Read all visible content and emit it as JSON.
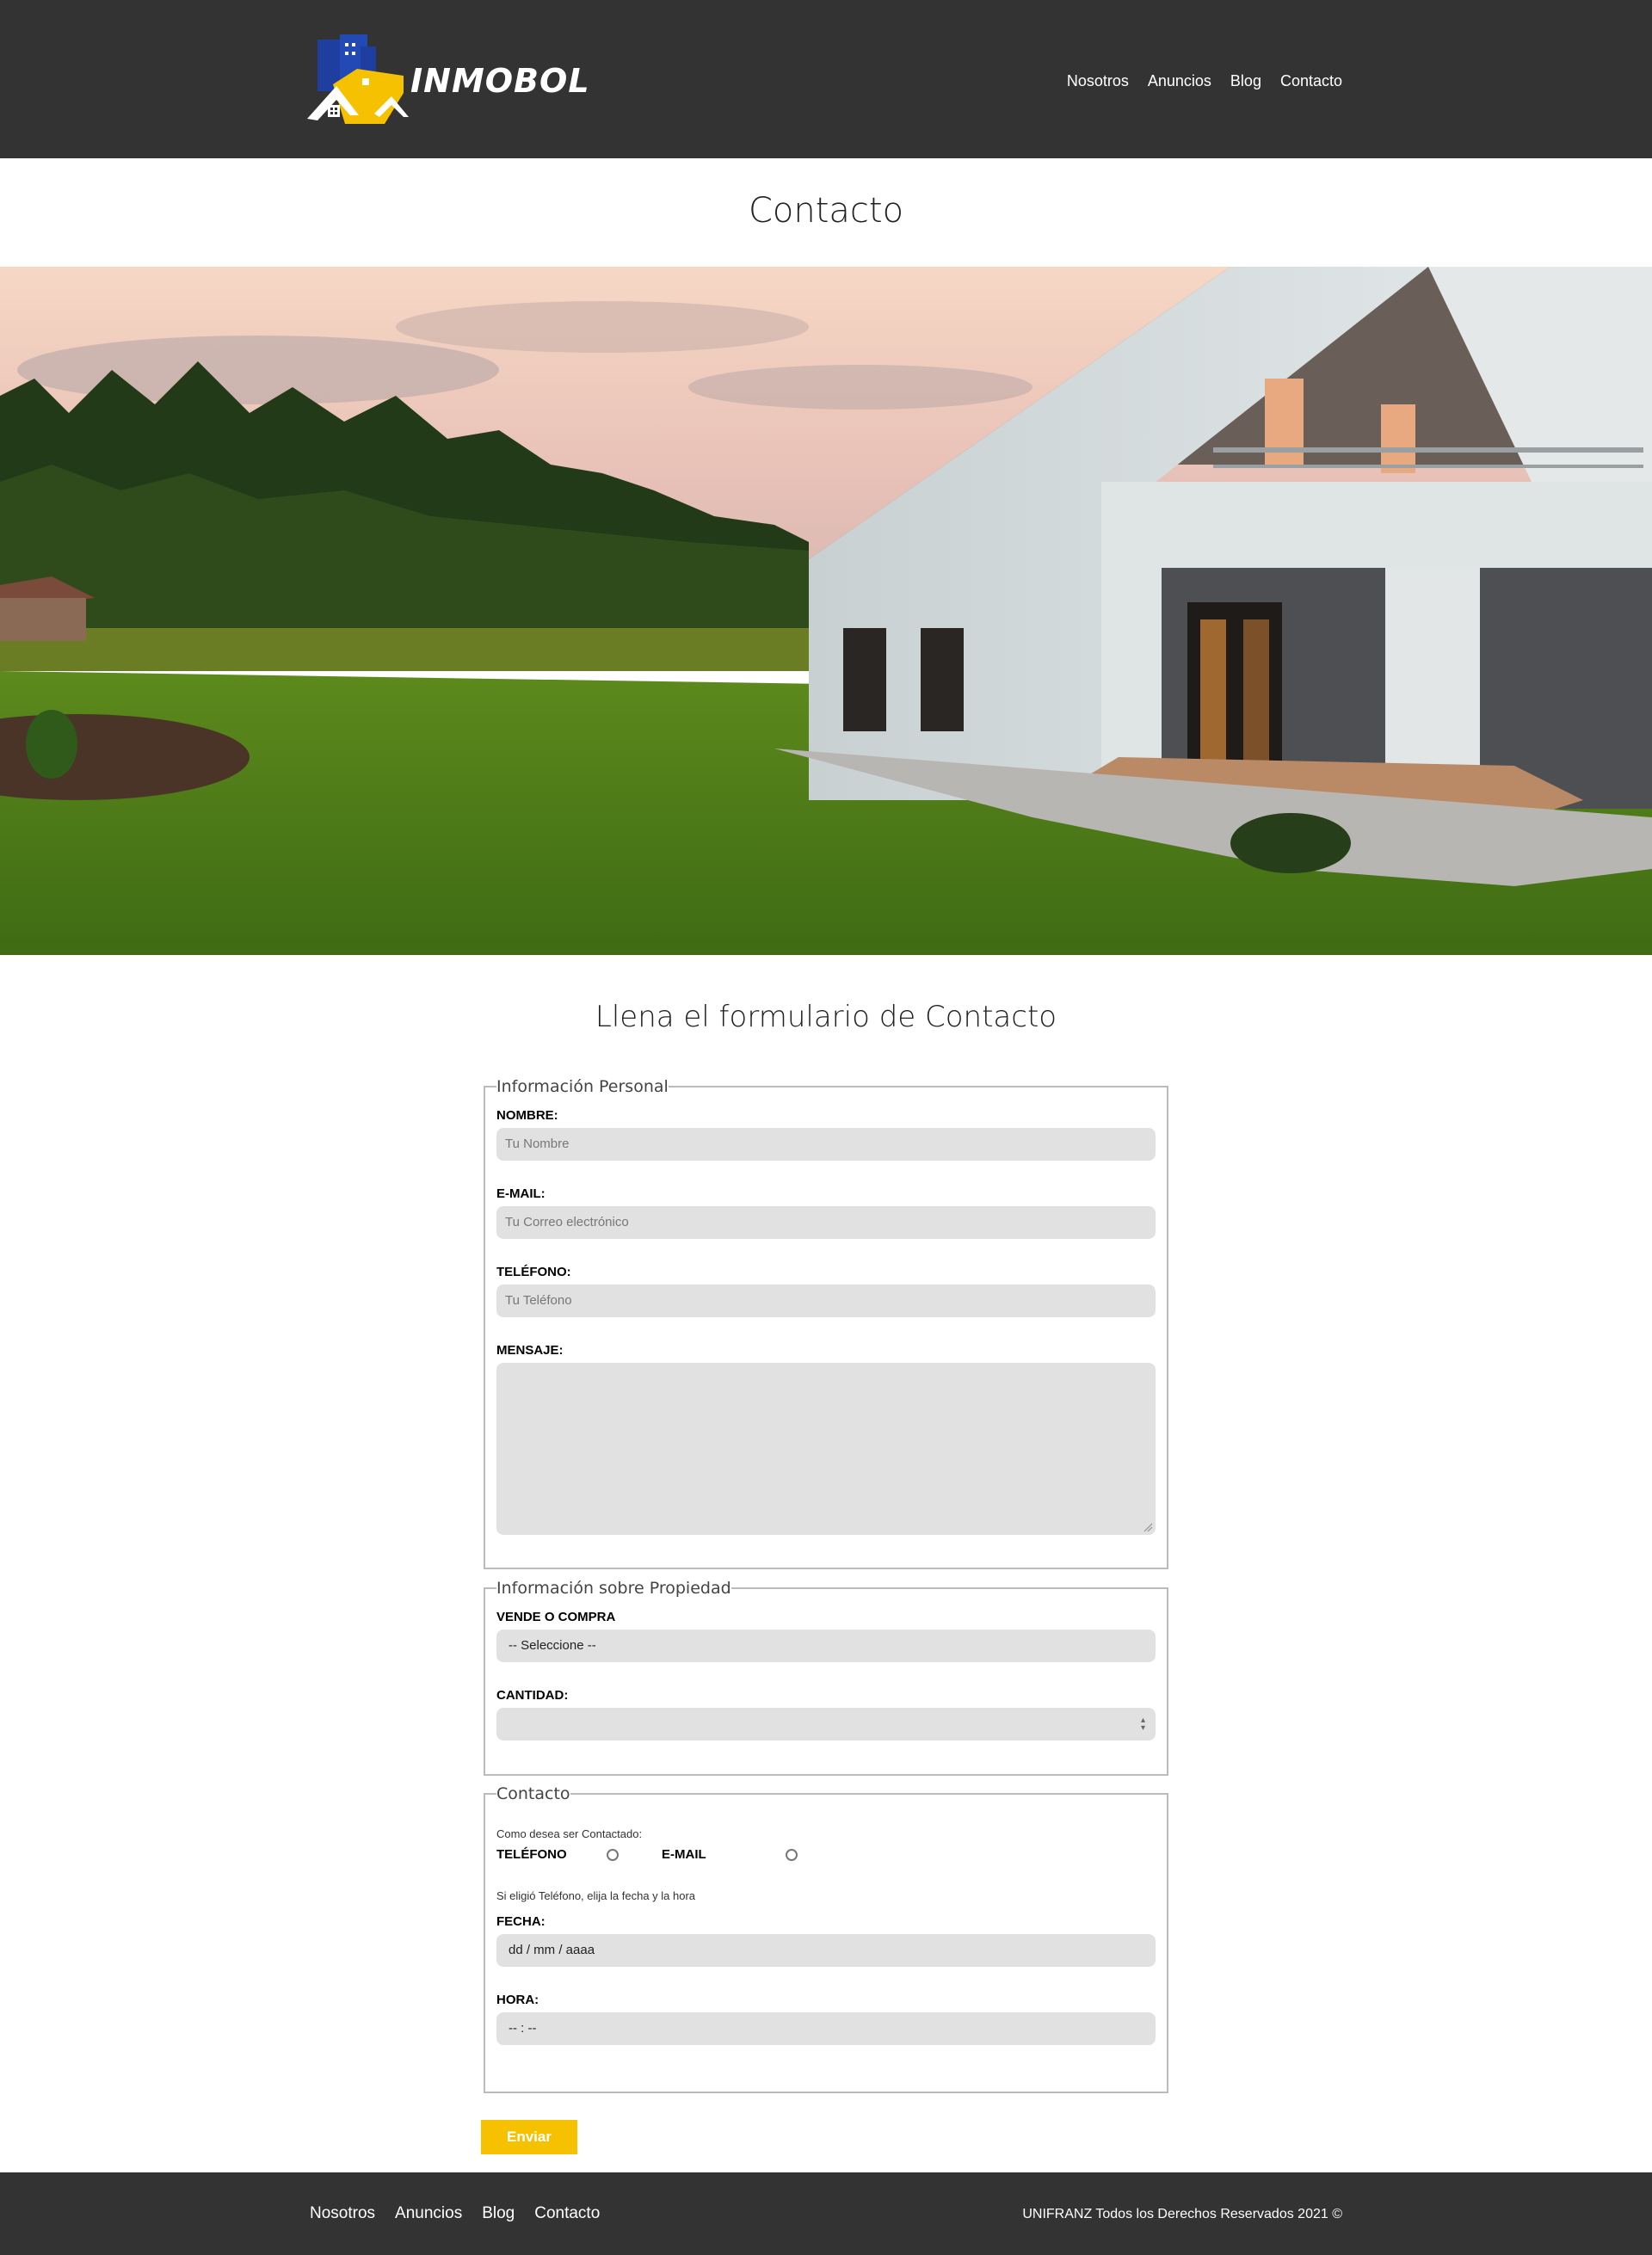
{
  "brand": {
    "name": "INMOBOL"
  },
  "nav": {
    "items": [
      "Nosotros",
      "Anuncios",
      "Blog",
      "Contacto"
    ]
  },
  "page": {
    "title": "Contacto"
  },
  "hero": {
    "description": "modern-house-photo"
  },
  "form": {
    "title": "Llena el formulario de Contacto",
    "personal": {
      "legend": "Información Personal",
      "name_label": "NOMBRE:",
      "name_placeholder": "Tu Nombre",
      "email_label": "E-MAIL:",
      "email_placeholder": "Tu Correo electrónico",
      "phone_label": "TELÉFONO:",
      "phone_placeholder": "Tu Teléfono",
      "message_label": "MENSAJE:"
    },
    "property": {
      "legend": "Información sobre Propiedad",
      "type_label": "VENDE O COMPRA",
      "type_value": "-- Seleccione --",
      "amount_label": "CANTIDAD:"
    },
    "contact": {
      "legend": "Contacto",
      "how_text": "Como desea ser Contactado:",
      "phone_option": "TELÉFONO",
      "email_option": "E-MAIL",
      "hint": "Si eligió Teléfono, elija la fecha y la hora",
      "date_label": "FECHA:",
      "date_value": "dd / mm / aaaa",
      "time_label": "HORA:",
      "time_value": "-- : --"
    },
    "submit_label": "Enviar"
  },
  "footer": {
    "nav": [
      "Nosotros",
      "Anuncios",
      "Blog",
      "Contacto"
    ],
    "copyright": "UNIFRANZ Todos los Derechos Reservados 2021 ©"
  },
  "colors": {
    "header_bg": "#333333",
    "accent": "#f5c100",
    "input_bg": "#e1e1e1"
  }
}
